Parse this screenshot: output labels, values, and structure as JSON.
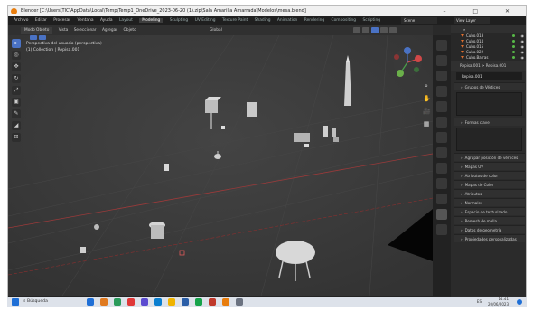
{
  "window": {
    "title": "Blender [C:\\Users\\TIC\\AppData\\Local\\Temp\\Temp1_OneDrive_2023-06-20 (1).zip\\Sala Amarilla Amarrada\\Modelos\\mesa.blend]",
    "controls": "–  □  ✕"
  },
  "menubar": {
    "items": [
      "Archivo",
      "Editar",
      "Procesar",
      "Ventana",
      "Ayuda"
    ],
    "workspaces": [
      "Layout",
      "Modeling",
      "Sculpting",
      "UV Editing",
      "Texture Paint",
      "Shading",
      "Animation",
      "Rendering",
      "Compositing",
      "Scripting"
    ],
    "active_workspace": "Modeling",
    "scene": "Scene",
    "view_layer": "View Layer"
  },
  "viewport_header": {
    "mode": "Modo Objeto",
    "items": [
      "Vista",
      "Seleccionar",
      "Agregar",
      "Objeto"
    ],
    "transform": "Global"
  },
  "viewport": {
    "view_name": "Perspectiva del usuario (perspectiva)",
    "collection": "(1) Collection | Repisa.001"
  },
  "toolbar": [
    "▸",
    "◎",
    "✥",
    "↻",
    "⤢",
    "▣",
    "✎",
    "◢",
    "⊞"
  ],
  "nav_buttons": [
    "⌕",
    "✋",
    "🎥",
    "▦"
  ],
  "outliner": {
    "rows": [
      "Cubo.013",
      "Cubo.014",
      "Cubo.015",
      "Cubo.022",
      "Cubo.Barras"
    ]
  },
  "properties": {
    "breadcrumb": "Repisa.001  >  Repisa.001",
    "object_name": "Repisa.001",
    "sections": [
      "Grupos de Vértices",
      "Formas clave",
      "Agrupar posición de vértices",
      "Mapas UV",
      "Atributos de color",
      "Mapas de Color",
      "Atributos",
      "Normales",
      "Espacio de texturizado",
      "Remesh de malla",
      "Datos de geometría",
      "Propiedades personalizadas"
    ]
  },
  "timeline": {
    "items": [
      "Seleccionar",
      "Rotar vista",
      "Menú contextual de objeto"
    ]
  },
  "taskbar": {
    "search": "Búsqueda",
    "app_colors": [
      "#1f6fd6",
      "#e07a20",
      "#2a9b5b",
      "#e03838",
      "#5b4bd0",
      "#0a7fd0",
      "#f0b400",
      "#2b5fa8",
      "#16a34a",
      "#c0392b",
      "#e87d0d",
      "#6b7280"
    ],
    "tray": "ES",
    "time": "14:41",
    "date": "20/06/2023"
  }
}
